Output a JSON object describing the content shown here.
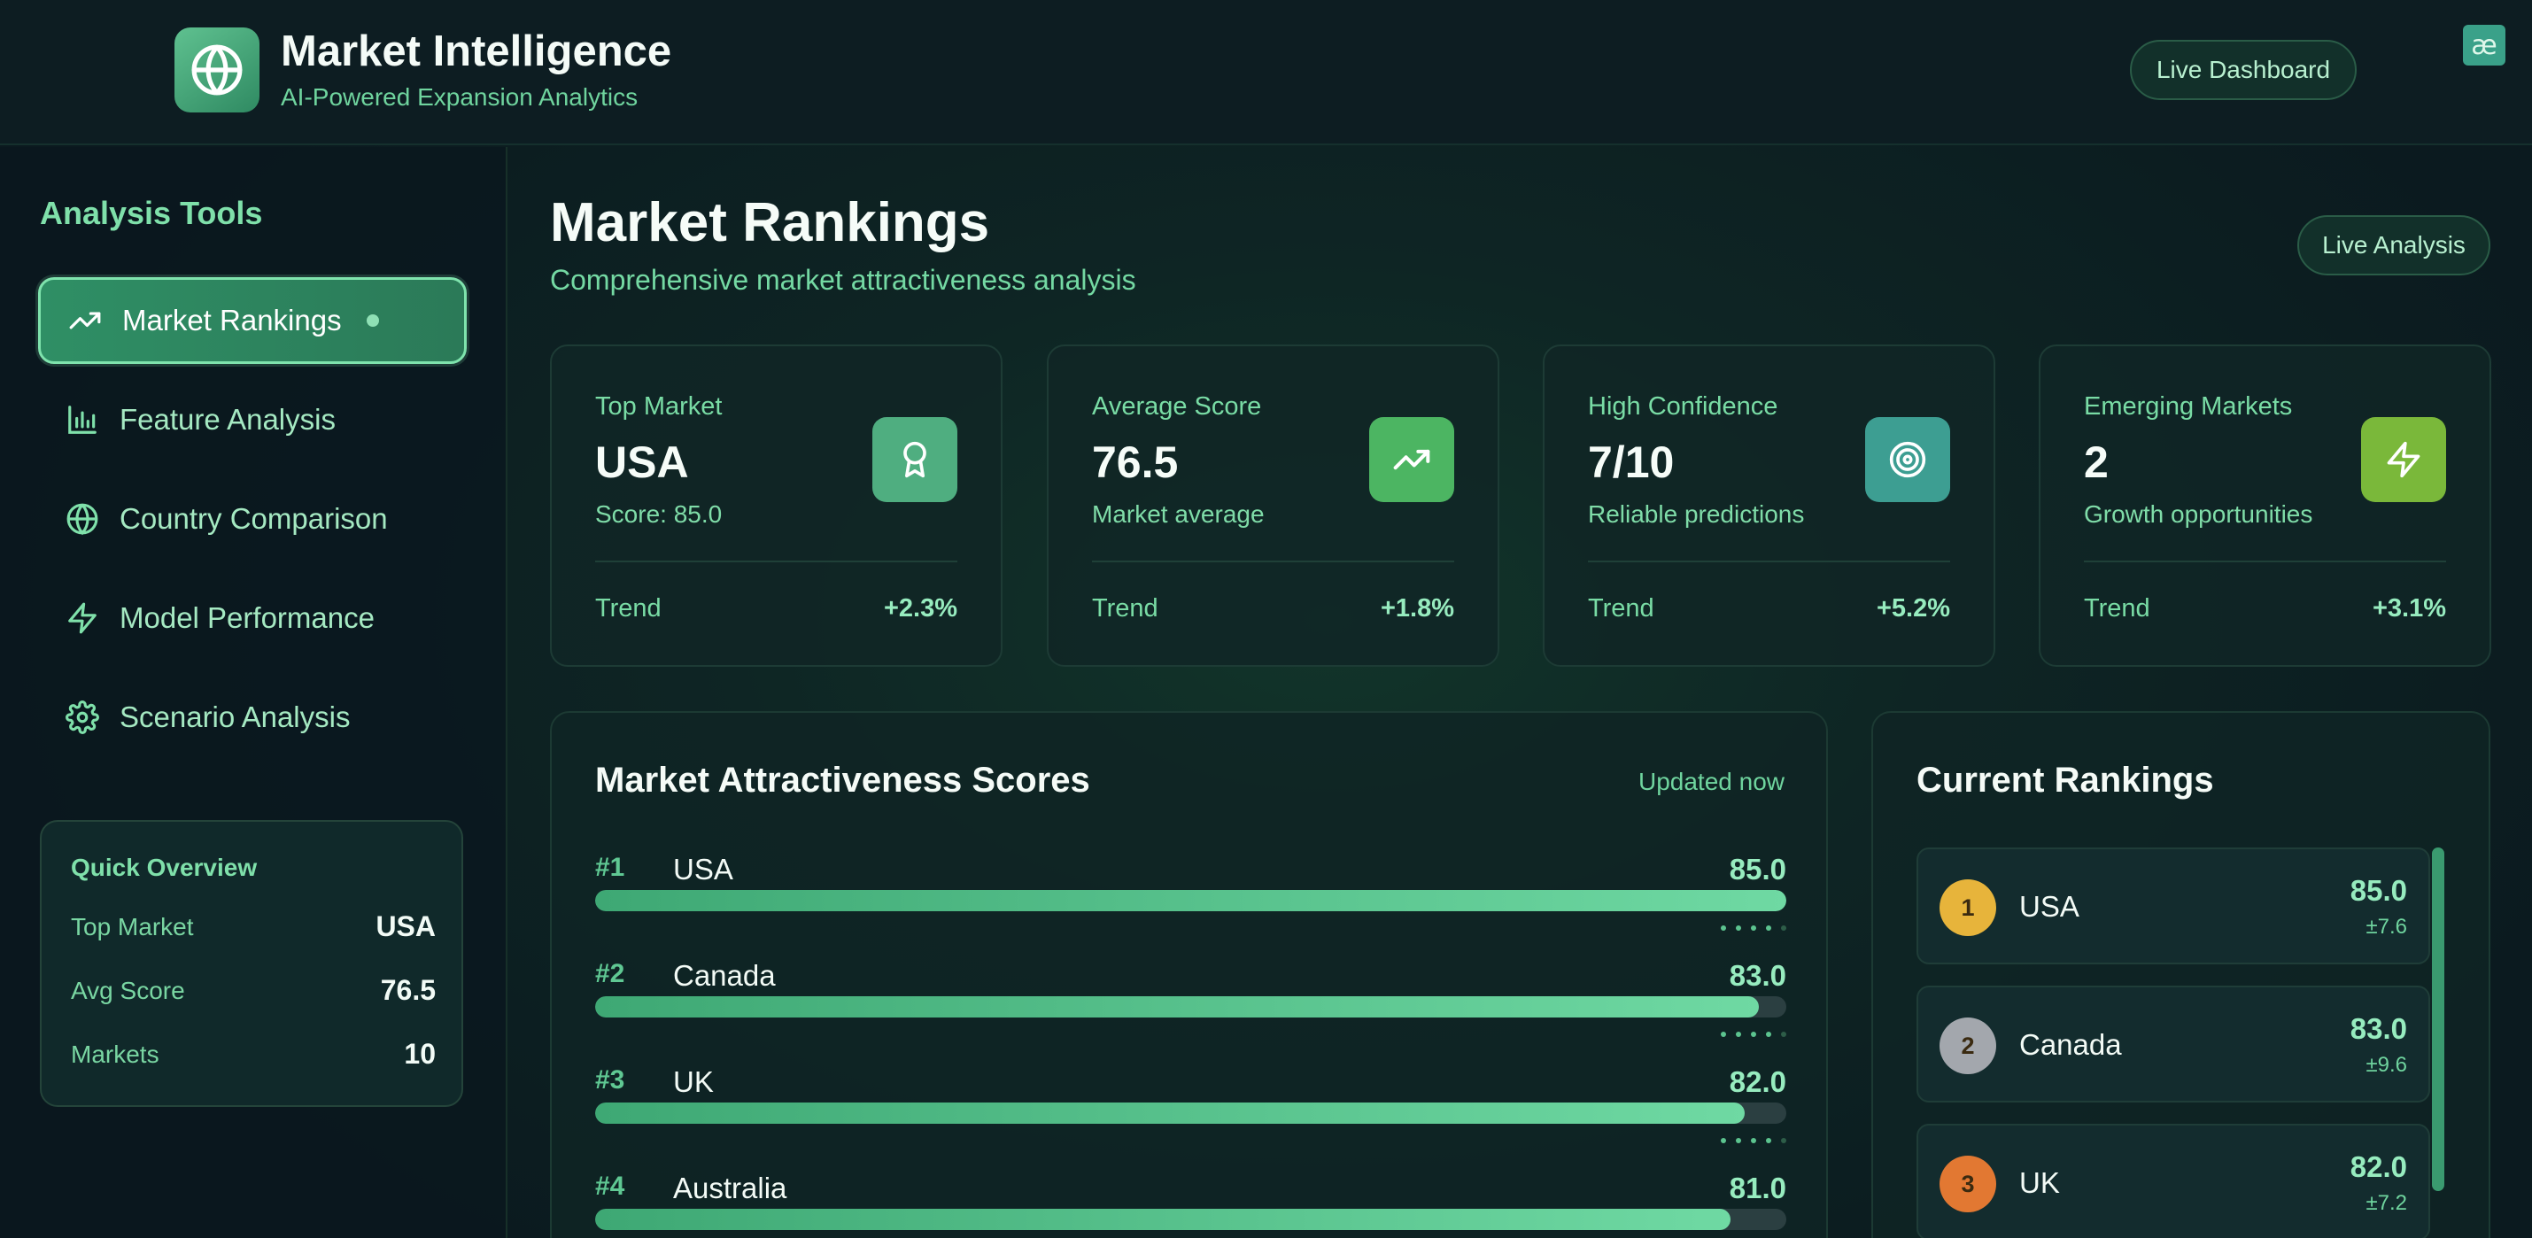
{
  "header": {
    "title": "Market Intelligence",
    "subtitle": "AI-Powered Expansion Analytics",
    "live_dashboard": "Live Dashboard",
    "corner_badge": "æ"
  },
  "sidebar": {
    "title": "Analysis Tools",
    "items": [
      {
        "label": "Market Rankings",
        "icon": "trending-up-icon",
        "active": true
      },
      {
        "label": "Feature Analysis",
        "icon": "bar-chart-icon",
        "active": false
      },
      {
        "label": "Country Comparison",
        "icon": "globe-icon",
        "active": false
      },
      {
        "label": "Model Performance",
        "icon": "zap-icon",
        "active": false
      },
      {
        "label": "Scenario Analysis",
        "icon": "gear-icon",
        "active": false
      }
    ],
    "overview": {
      "title": "Quick Overview",
      "rows": [
        {
          "label": "Top Market",
          "value": "USA"
        },
        {
          "label": "Avg Score",
          "value": "76.5"
        },
        {
          "label": "Markets",
          "value": "10"
        }
      ]
    }
  },
  "main": {
    "title": "Market Rankings",
    "subtitle": "Comprehensive market attractiveness analysis",
    "live_analysis": "Live Analysis",
    "kpis": [
      {
        "label": "Top Market",
        "value": "USA",
        "sub": "Score: 85.0",
        "trend_label": "Trend",
        "trend": "+2.3%",
        "icon": "award-icon",
        "color": "#4fae80"
      },
      {
        "label": "Average Score",
        "value": "76.5",
        "sub": "Market average",
        "trend_label": "Trend",
        "trend": "+1.8%",
        "icon": "trending-up-icon",
        "color": "#4cb562"
      },
      {
        "label": "High Confidence",
        "value": "7/10",
        "sub": "Reliable predictions",
        "trend_label": "Trend",
        "trend": "+5.2%",
        "icon": "target-icon",
        "color": "#3d9e92"
      },
      {
        "label": "Emerging Markets",
        "value": "2",
        "sub": "Growth opportunities",
        "trend_label": "Trend",
        "trend": "+3.1%",
        "icon": "zap-icon",
        "color": "#7ab83a"
      }
    ],
    "scores_panel": {
      "title": "Market Attractiveness Scores",
      "meta": "Updated now",
      "rows": [
        {
          "rank": "#1",
          "name": "USA",
          "value": "85.0",
          "fill": 1.0
        },
        {
          "rank": "#2",
          "name": "Canada",
          "value": "83.0",
          "fill": 0.977
        },
        {
          "rank": "#3",
          "name": "UK",
          "value": "82.0",
          "fill": 0.965
        },
        {
          "rank": "#4",
          "name": "Australia",
          "value": "81.0",
          "fill": 0.953
        }
      ]
    },
    "rankings_panel": {
      "title": "Current Rankings",
      "items": [
        {
          "pos": "1",
          "name": "USA",
          "score": "85.0",
          "err": "±7.6",
          "color": "#e7b43b"
        },
        {
          "pos": "2",
          "name": "Canada",
          "score": "83.0",
          "err": "±9.6",
          "color": "#a3a7ad"
        },
        {
          "pos": "3",
          "name": "UK",
          "score": "82.0",
          "err": "±7.2",
          "color": "#e27832"
        }
      ]
    }
  }
}
